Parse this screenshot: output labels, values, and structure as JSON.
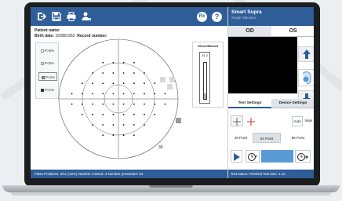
{
  "app": {
    "title": "Smart Supra",
    "subtitle": "Single Stimulus"
  },
  "toolbar": {
    "icons": [
      "exit-icon",
      "save-icon",
      "print-icon",
      "patient-icon"
    ],
    "rx_label": "Rx",
    "help_label": "?"
  },
  "patient": {
    "name_label": "Patient name:",
    "birth_label": "Birth date:",
    "birth_value": "15/08/1953",
    "record_label": "Record number:"
  },
  "legend": {
    "items": [
      {
        "label": "P>5%",
        "color": "#ffffff"
      },
      {
        "label": "P<5%",
        "color": "#d8d8d8"
      },
      {
        "label": "P<2%",
        "color": "#9a9a9a"
      },
      {
        "label": "P<1%",
        "color": "#333333"
      }
    ],
    "selected_index": 2
  },
  "field": {
    "bottom_label": "30"
  },
  "seen_missed": {
    "title": "#Seen/Missed",
    "grid_label": "24-2",
    "level": 0.15
  },
  "status": {
    "left": "False Positives: 2/11 (18%)   Number missed: 4   Number presented: 54",
    "right": "Test status: Finished   Test time: 1:12"
  },
  "eye_tabs": {
    "od": "OD",
    "os": "OS",
    "active": "OD"
  },
  "settings_tabs": {
    "test": "Test Settings",
    "device": "Device Settings",
    "active": "Test Settings"
  },
  "controls": {
    "auto": "Auto",
    "man": "Man",
    "point_26": "26 Point",
    "point_54": "54 Point",
    "point_86": "86 Point",
    "selected_point": "54 Point"
  },
  "colors": {
    "primary": "#2f5d97",
    "accent_red": "#d32f2f",
    "accent_blue": "#5b9bd5",
    "laptop": "#1c1d1f"
  }
}
